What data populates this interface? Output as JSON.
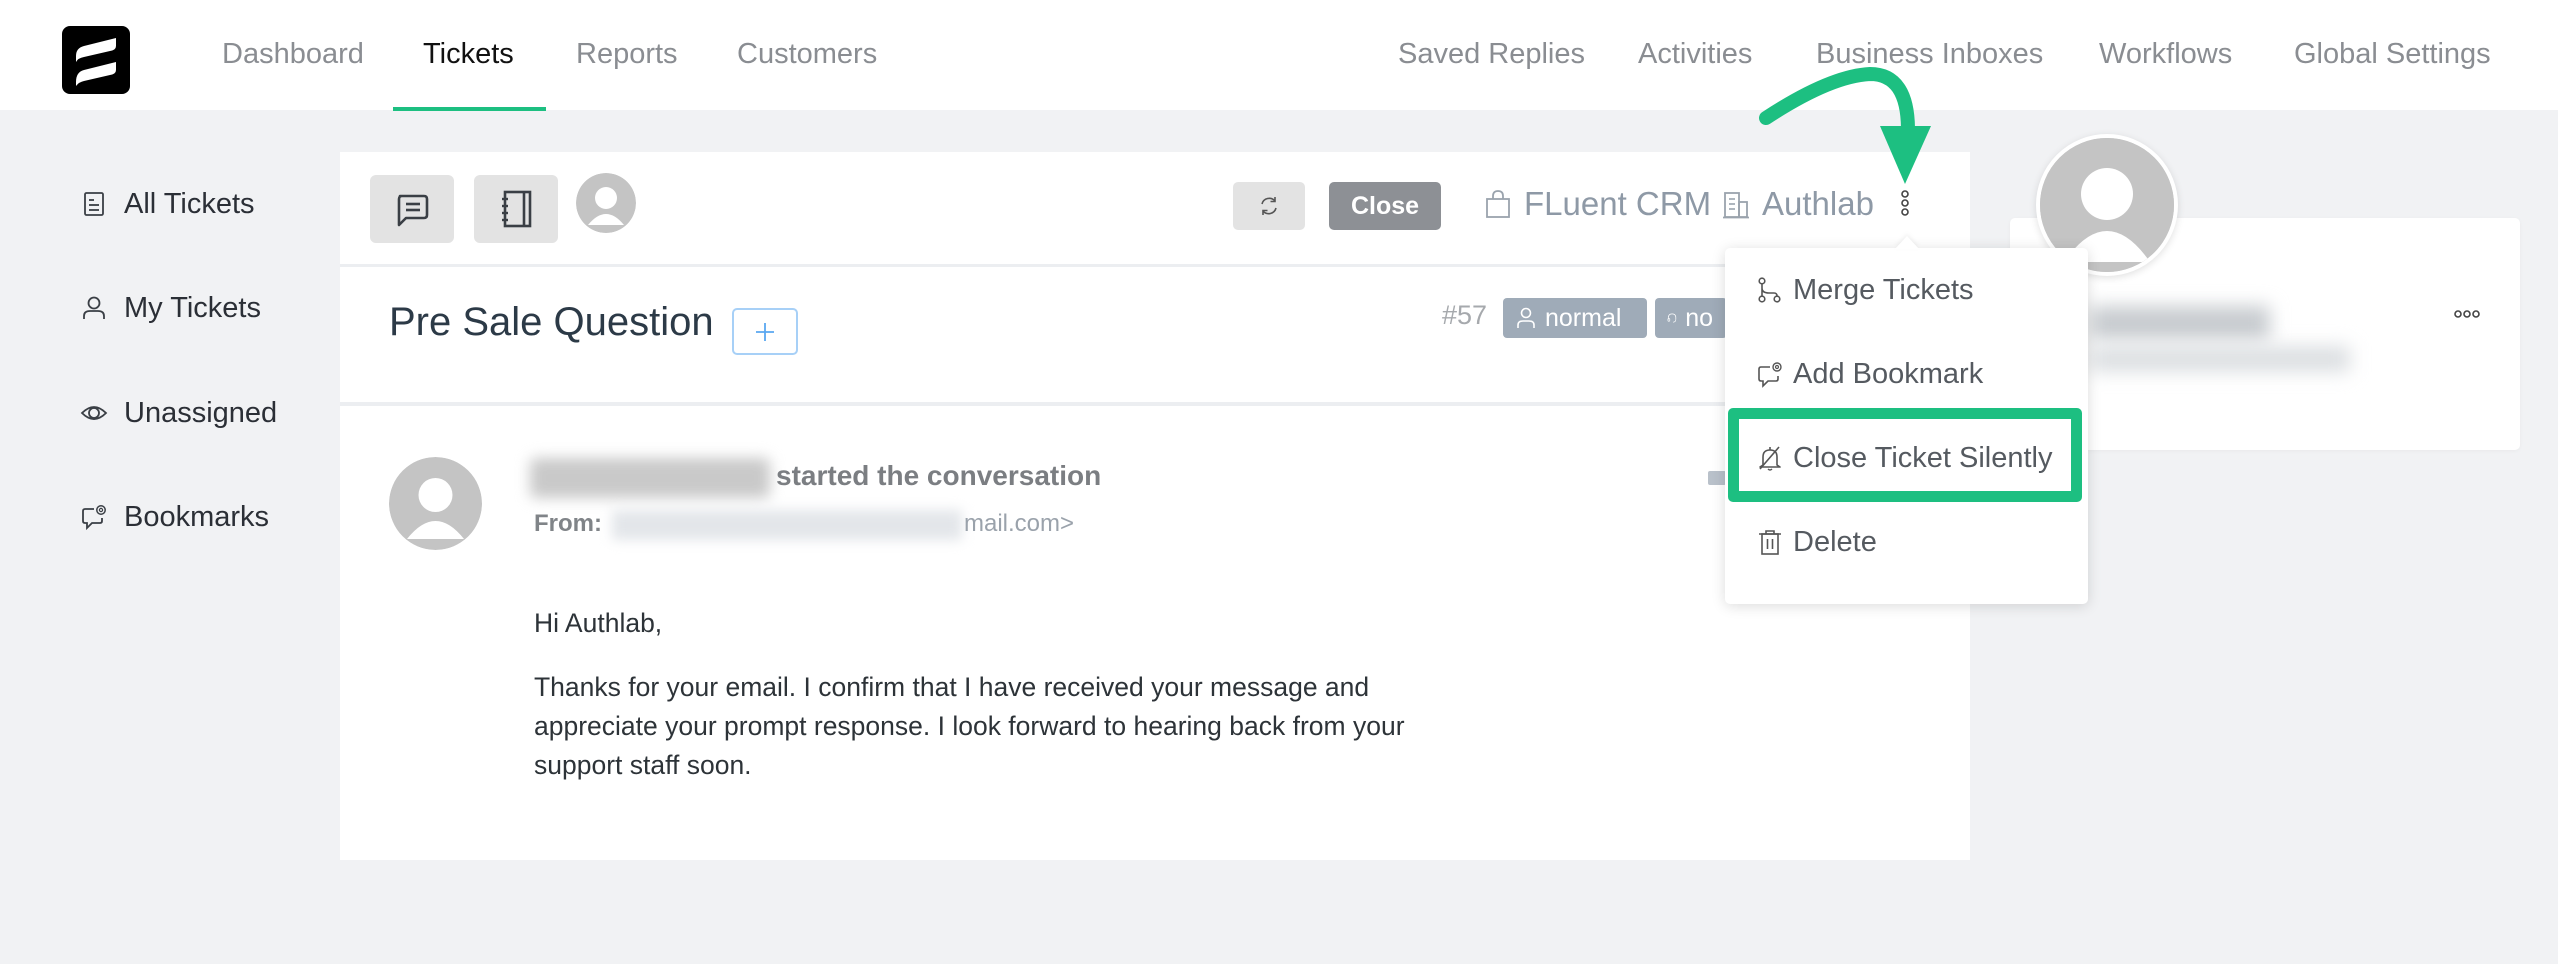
{
  "header": {
    "logo": "fluent-support-logo",
    "nav_left": [
      {
        "label": "Dashboard",
        "active": false
      },
      {
        "label": "Tickets",
        "active": true
      },
      {
        "label": "Reports",
        "active": false
      },
      {
        "label": "Customers",
        "active": false
      }
    ],
    "nav_right": [
      {
        "label": "Saved Replies"
      },
      {
        "label": "Activities"
      },
      {
        "label": "Business Inboxes"
      },
      {
        "label": "Workflows"
      },
      {
        "label": "Global Settings"
      }
    ]
  },
  "sidebar": {
    "items": [
      {
        "label": "All Tickets",
        "icon": "document-icon"
      },
      {
        "label": "My Tickets",
        "icon": "user-icon"
      },
      {
        "label": "Unassigned",
        "icon": "eye-icon"
      },
      {
        "label": "Bookmarks",
        "icon": "chat-at-icon"
      }
    ]
  },
  "toolbar": {
    "conversation_icon": "chat-icon",
    "notes_icon": "notebook-icon",
    "refresh_icon": "refresh-icon",
    "close_label": "Close",
    "product_label": "FLuent CRM",
    "business_label": "Authlab",
    "more_icon": "kebab-vertical-icon"
  },
  "ticket": {
    "title": "Pre Sale Question",
    "add_tag_symbol": "+",
    "id": "#57",
    "badges": [
      {
        "icon": "user-icon",
        "label": "normal"
      },
      {
        "icon": "headset-icon",
        "label": "no"
      }
    ]
  },
  "conversation": {
    "action_text": "started the conversation",
    "from_label": "From:",
    "email_visible_suffix": "mail.com>",
    "greeting": "Hi Authlab,",
    "body": "Thanks for your email. I confirm that I have received your message and appreciate your prompt response. I look forward to hearing back from your support staff soon."
  },
  "dropdown": {
    "items": [
      {
        "label": "Merge Tickets",
        "icon": "merge-icon",
        "highlighted": false
      },
      {
        "label": "Add Bookmark",
        "icon": "chat-at-icon",
        "highlighted": false
      },
      {
        "label": "Close Ticket Silently",
        "icon": "bell-off-icon",
        "highlighted": true
      },
      {
        "label": "Delete",
        "icon": "trash-icon",
        "highlighted": false
      }
    ]
  },
  "customer_card": {
    "more_icon": "ellipsis-horizontal-icon"
  },
  "annotation": {
    "color": "#1dbf81",
    "type": "curved-arrow-and-highlight-box"
  },
  "colors": {
    "accent": "#1dbf81",
    "badge": "#9fabb8",
    "close_button": "#8d9095",
    "page_bg": "#f1f2f4"
  }
}
